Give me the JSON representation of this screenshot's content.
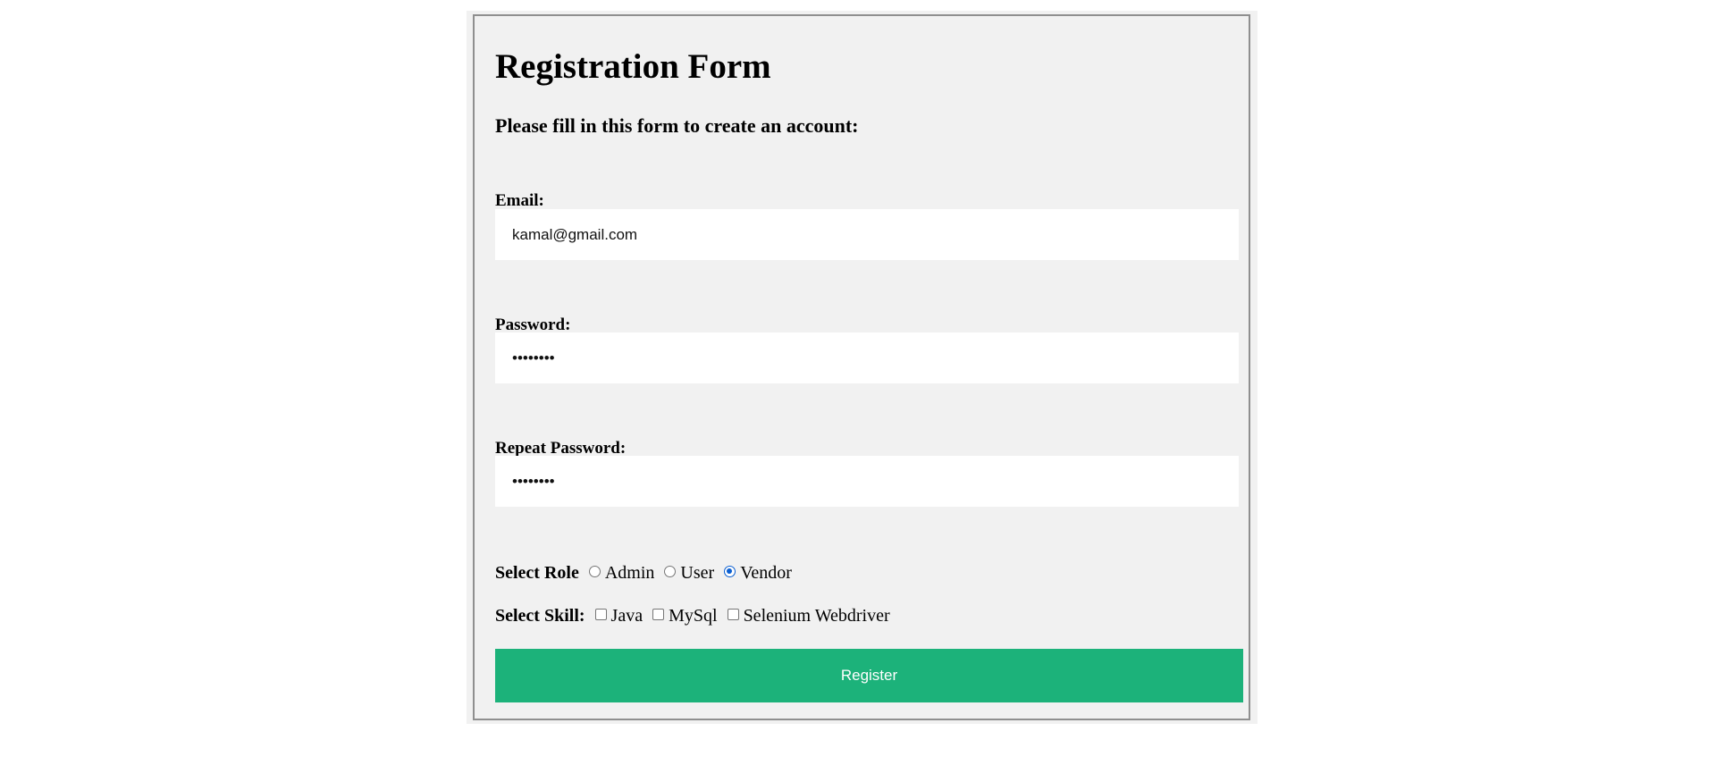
{
  "form": {
    "title": "Registration Form",
    "subtitle": "Please fill in this form to create an account:",
    "email": {
      "label": "Email:",
      "value": "kamal@gmail.com"
    },
    "password": {
      "label": "Password:",
      "value": "••••••••"
    },
    "repeat_password": {
      "label": "Repeat Password:",
      "value": "••••••••"
    },
    "role": {
      "label": "Select Role",
      "options": [
        "Admin",
        "User",
        "Vendor"
      ],
      "selected": "Vendor"
    },
    "skill": {
      "label": "Select Skill:",
      "options": [
        "Java",
        "MySql",
        "Selenium Webdriver"
      ]
    },
    "register_label": "Register"
  },
  "colors": {
    "accent": "#1cb27a",
    "panel": "#f1f1f1",
    "radio_selected": "#0b5fd1"
  }
}
